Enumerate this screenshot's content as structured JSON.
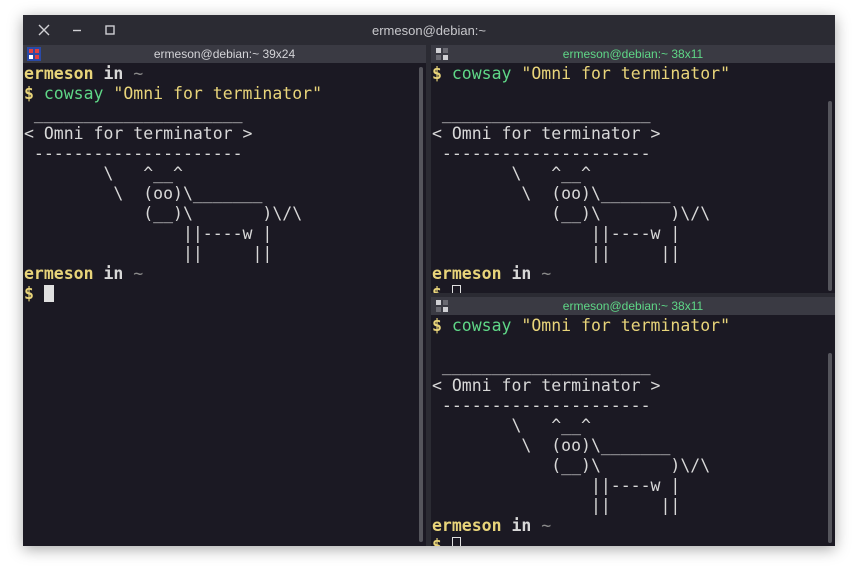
{
  "window": {
    "title": "ermeson@debian:~"
  },
  "panes": [
    {
      "id": "left",
      "title": "ermeson@debian:~ 39x24",
      "prompt_user": "ermeson",
      "prompt_in": " in ",
      "prompt_dir": "~",
      "dollar": "$",
      "command": "cowsay",
      "command_arg": "\"Omni for terminator\"",
      "output": " _____________________\n< Omni for terminator >\n ---------------------\n        \\   ^__^\n         \\  (oo)\\_______\n            (__)\\       )\\/\\\n                ||----w |\n                ||     ||",
      "prompt2_user": "ermeson",
      "prompt2_in": " in ",
      "prompt2_dir": "~",
      "dollar2": "$"
    },
    {
      "id": "top-right",
      "title": "ermeson@debian:~ 38x11",
      "dollar": "$",
      "command": "cowsay",
      "command_arg": "\"Omni for terminator\"",
      "output": "\n _____________________\n< Omni for terminator >\n ---------------------\n        \\   ^__^\n         \\  (oo)\\_______\n            (__)\\       )\\/\\\n                ||----w |\n                ||     ||",
      "prompt2_user": "ermeson",
      "prompt2_in": " in ",
      "prompt2_dir": "~",
      "dollar2": "$"
    },
    {
      "id": "bottom-right",
      "title": "ermeson@debian:~ 38x11",
      "dollar": "$",
      "command": "cowsay",
      "command_arg": "\"Omni for terminator\"",
      "output": "\n _____________________\n< Omni for terminator >\n ---------------------\n        \\   ^__^\n         \\  (oo)\\_______\n            (__)\\       )\\/\\\n                ||----w |\n                ||     ||",
      "prompt2_user": "ermeson",
      "prompt2_in": " in ",
      "prompt2_dir": "~",
      "dollar2": "$"
    }
  ],
  "colors": {
    "background": "#1b1923",
    "prompt_user": "#e8d47a",
    "command": "#5fd787",
    "inactive_title": "#5fd787"
  }
}
